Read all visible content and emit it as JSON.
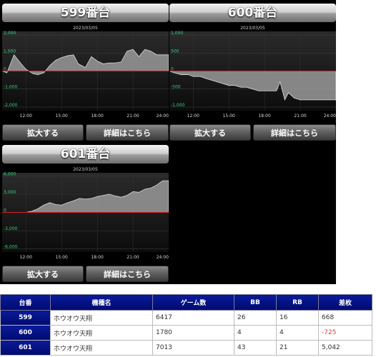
{
  "colors": {
    "area": "#9a9a9a",
    "zero_line": "#d42020",
    "ytick": "#2bd87a",
    "header_bg": "#0a1a9a",
    "negative": "#e23b3b"
  },
  "panels": [
    {
      "title": "599番台",
      "date": "2023/03/05",
      "buttons": {
        "zoom": "拡大する",
        "details": "詳細はこちら"
      },
      "chart_data": {
        "type": "area",
        "xticks": [
          "12:00",
          "15:00",
          "18:00",
          "21:00",
          "24:00"
        ],
        "yticks": [
          "2,000",
          "1,000",
          "0",
          "-1,000",
          "-2,000"
        ],
        "ylim": [
          -2200,
          2200
        ],
        "x": [
          10,
          10.4,
          11,
          11.6,
          12,
          12.6,
          13,
          13.5,
          14,
          14.5,
          15,
          15.5,
          16,
          16.4,
          17,
          17.5,
          18,
          18.5,
          19,
          19.5,
          20,
          20.5,
          21,
          21.5,
          22,
          22.5,
          23,
          23.5,
          24
        ],
        "y": [
          0,
          -100,
          900,
          400,
          100,
          -150,
          -200,
          -100,
          300,
          600,
          750,
          850,
          900,
          400,
          200,
          800,
          550,
          400,
          450,
          450,
          500,
          1100,
          1200,
          800,
          1200,
          1100,
          900,
          900,
          900
        ]
      }
    },
    {
      "title": "600番台",
      "date": "2023/03/05",
      "buttons": {
        "zoom": "拡大する",
        "details": "詳細はこちら"
      },
      "chart_data": {
        "type": "area",
        "xticks": [
          "12:00",
          "15:00",
          "18:00",
          "21:00",
          "24:00"
        ],
        "yticks": [
          "1,000",
          "500",
          "0",
          "-500",
          "-1,000"
        ],
        "ylim": [
          -1100,
          1100
        ],
        "x": [
          10,
          10.4,
          11,
          11.6,
          12,
          12.6,
          13,
          13.5,
          14,
          14.5,
          15,
          15.5,
          16,
          16.5,
          17,
          17.5,
          18,
          18.5,
          19,
          19.3,
          19.7,
          20,
          20.5,
          21,
          21.5,
          22,
          22.5,
          23,
          23.5,
          24
        ],
        "y": [
          0,
          -50,
          -100,
          -100,
          -150,
          -150,
          -200,
          -250,
          -300,
          -350,
          -400,
          -400,
          -450,
          -450,
          -500,
          -550,
          -550,
          -550,
          -550,
          -300,
          -800,
          -600,
          -750,
          -800,
          -800,
          -800,
          -800,
          -800,
          -800,
          -800
        ]
      }
    },
    {
      "title": "601番台",
      "date": "2023/03/05",
      "buttons": {
        "zoom": "拡大する",
        "details": "詳細はこちら"
      },
      "chart_data": {
        "type": "area",
        "xticks": [
          "12:00",
          "15:00",
          "18:00",
          "21:00",
          "24:00"
        ],
        "yticks": [
          "6,000",
          "3,000",
          "0",
          "-3,000",
          "-6,000"
        ],
        "ylim": [
          -6500,
          6500
        ],
        "x": [
          10,
          11,
          12,
          12.5,
          13,
          13.5,
          14,
          14.5,
          15,
          15.5,
          16,
          16.5,
          17,
          17.5,
          18,
          18.5,
          19,
          19.5,
          20,
          20.5,
          21,
          21.5,
          22,
          22.5,
          23,
          23.5,
          24
        ],
        "y": [
          0,
          0,
          0,
          200,
          600,
          1200,
          1600,
          1300,
          1200,
          1600,
          1900,
          2300,
          2200,
          2300,
          2600,
          2800,
          3000,
          2700,
          2500,
          2800,
          3400,
          3300,
          3800,
          4000,
          4500,
          5200,
          5200
        ]
      }
    }
  ],
  "table": {
    "headers": [
      "台番",
      "機種名",
      "ゲーム数",
      "BB",
      "RB",
      "差枚"
    ],
    "rows": [
      {
        "no": "599",
        "model": "ホウオウ天翔",
        "games": "6417",
        "bb": "26",
        "rb": "16",
        "diff": "668"
      },
      {
        "no": "600",
        "model": "ホウオウ天翔",
        "games": "1780",
        "bb": "4",
        "rb": "4",
        "diff": "-725"
      },
      {
        "no": "601",
        "model": "ホウオウ天翔",
        "games": "7013",
        "bb": "43",
        "rb": "21",
        "diff": "5,042"
      }
    ]
  }
}
